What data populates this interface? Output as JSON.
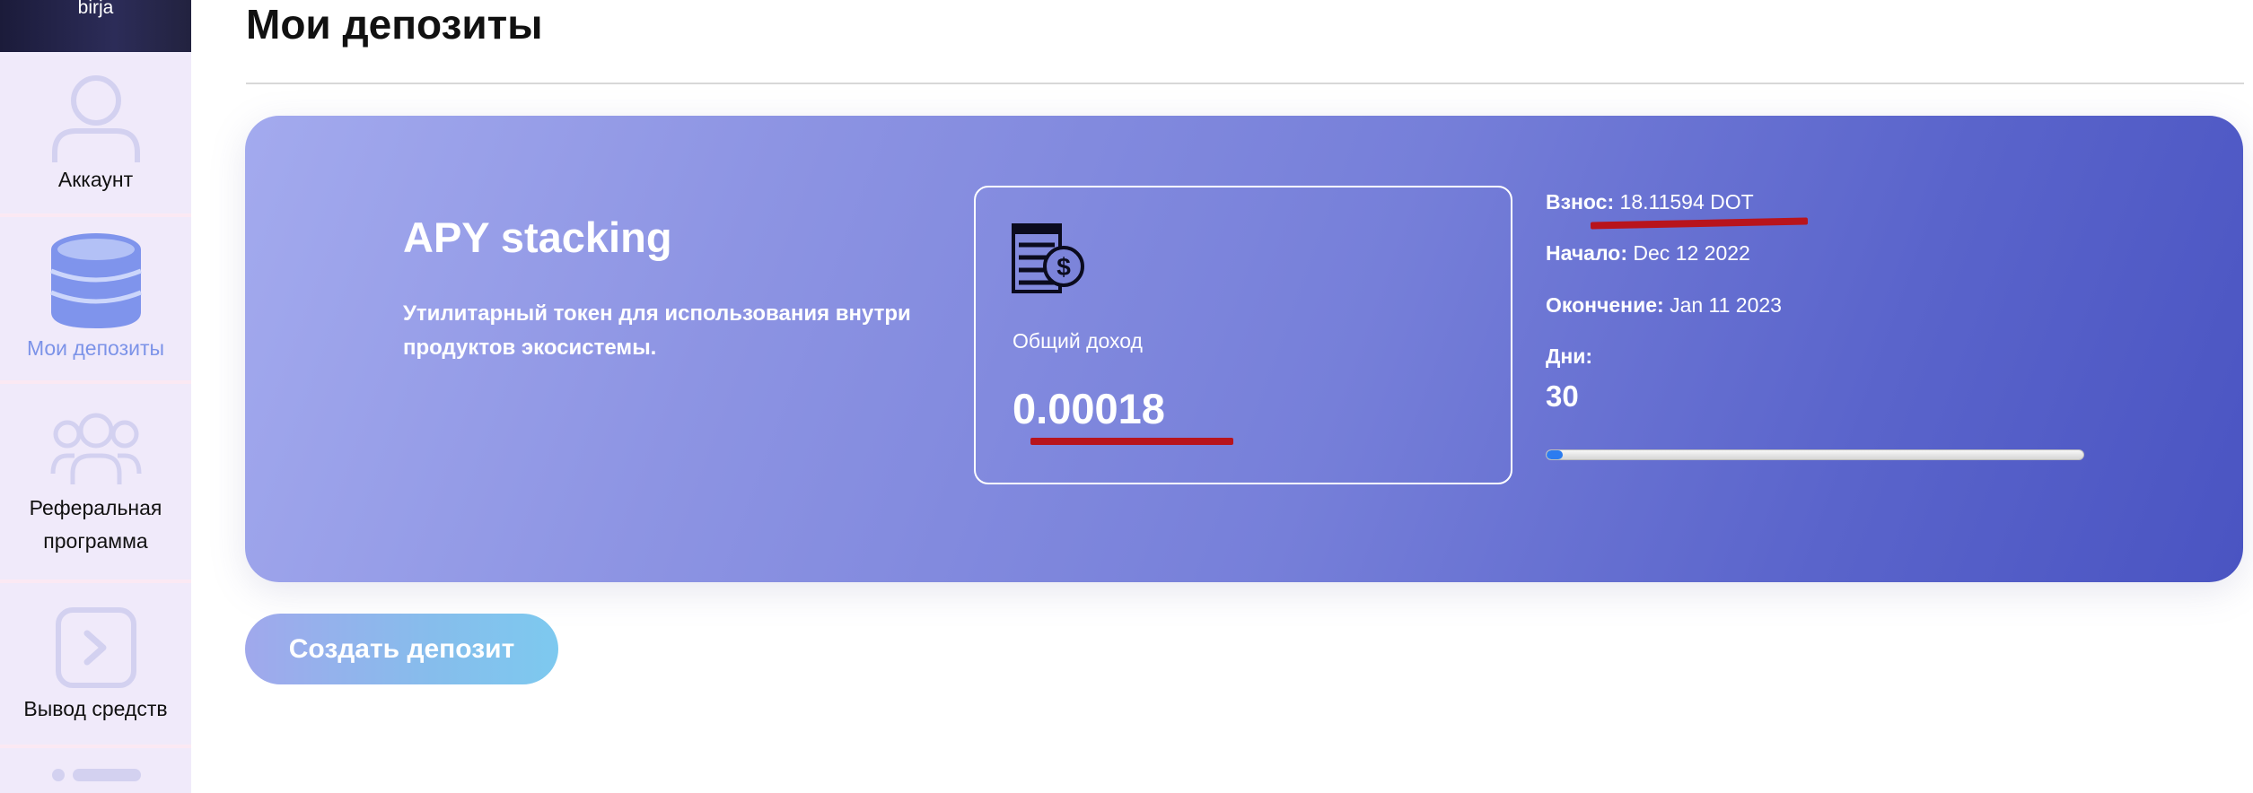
{
  "sidebar": {
    "brand": "birja",
    "items": [
      {
        "label": "Аккаунт"
      },
      {
        "label": "Мои депозиты"
      },
      {
        "label": "Реферальная программа"
      },
      {
        "label": "Вывод средств"
      }
    ]
  },
  "page": {
    "title": "Мои депозиты"
  },
  "deposit": {
    "title": "APY stacking",
    "description": "Утилитарный токен для использования внутри продуктов экосистемы.",
    "income_label": "Общий доход",
    "income_value": "0.00018",
    "contribution_label": "Взнос:",
    "contribution_value": "18.11594 DOT",
    "start_label": "Начало:",
    "start_value": "Dec 12 2022",
    "end_label": "Окончение:",
    "end_value": "Jan 11 2023",
    "days_label": "Дни:",
    "days_value": "30",
    "progress_percent": 3
  },
  "actions": {
    "create_label": "Создать депозит"
  },
  "colors": {
    "accent": "#7c93e8",
    "card_start": "#a3aaee",
    "card_end": "#4a54c2",
    "annotation_red": "#b8141c",
    "progress_blue": "#2c7cf0"
  }
}
